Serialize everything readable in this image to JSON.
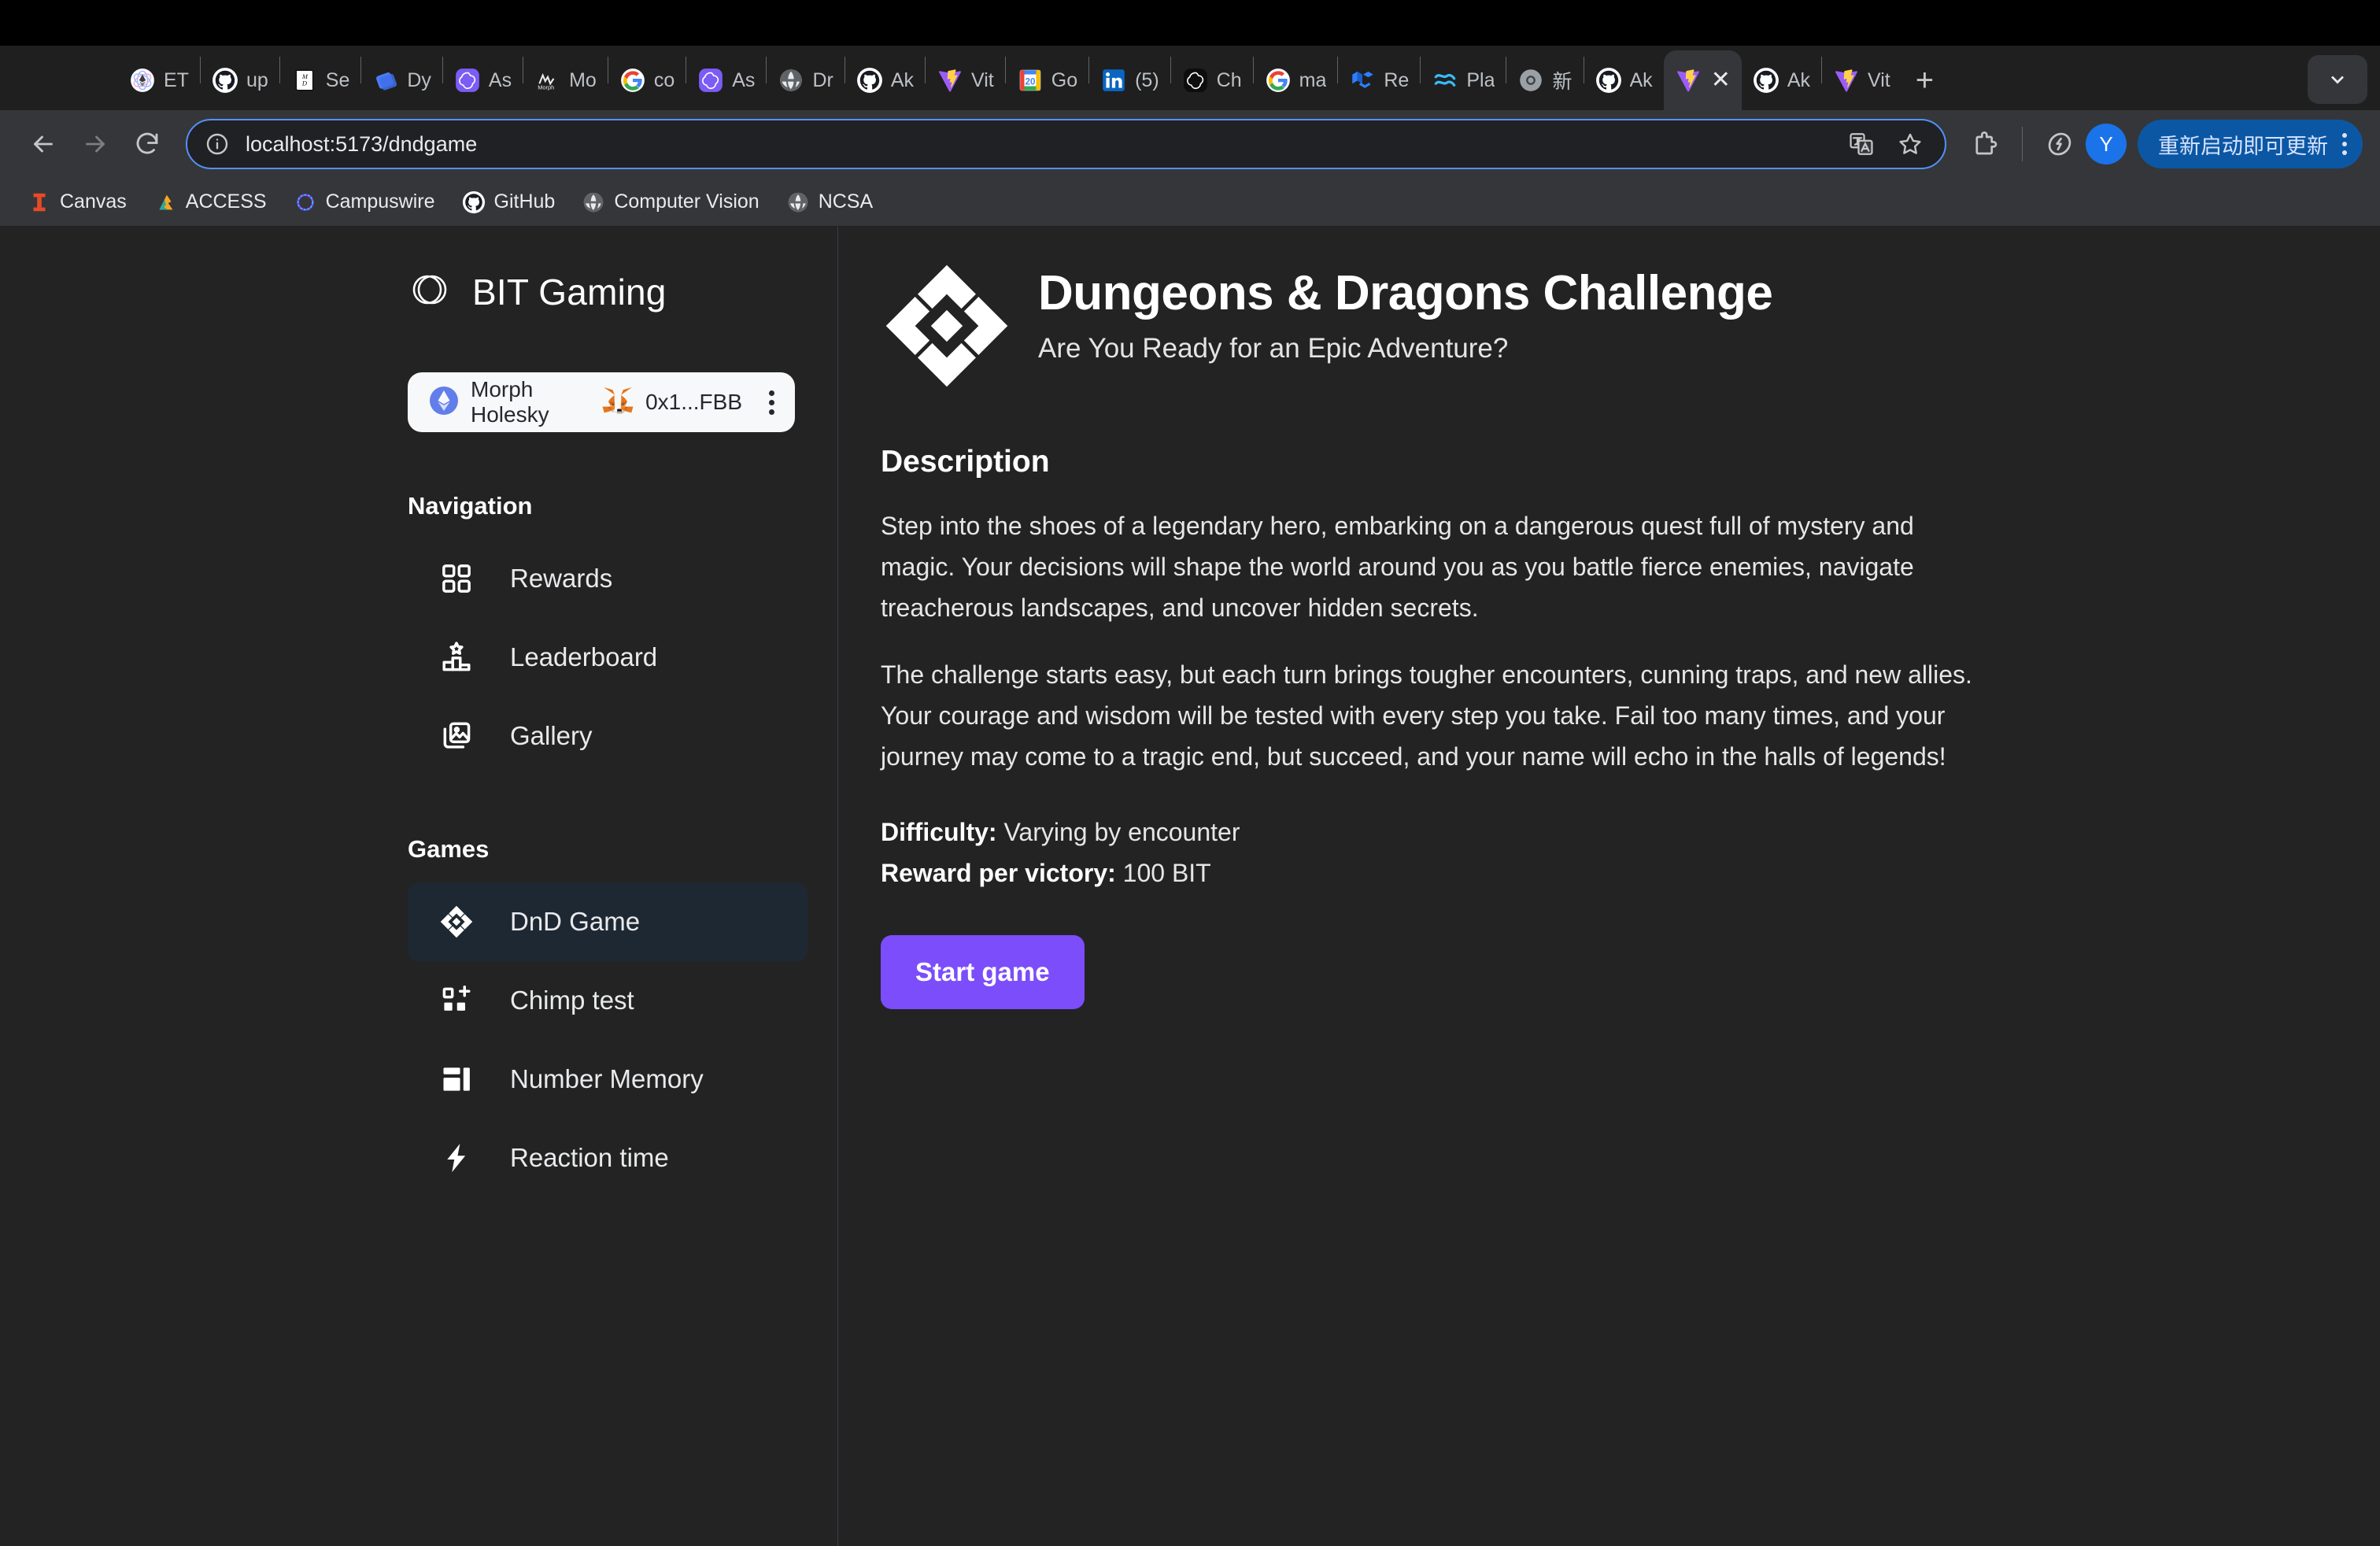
{
  "browser": {
    "nav": {
      "back_icon": "back-arrow-icon",
      "forward_icon": "forward-arrow-icon",
      "reload_icon": "reload-icon"
    },
    "omnibox": {
      "info_icon": "site-info-icon",
      "url": "localhost:5173/dndgame",
      "translate_icon": "translate-icon",
      "bookmark_icon": "star-icon"
    },
    "toolbar": {
      "extensions_icon": "extensions-icon",
      "leaf_icon": "performance-leaf-icon",
      "profile_initial": "Y",
      "update_label": "重新启动即可更新",
      "menu_icon": "kebab-menu-icon"
    },
    "tabstrip": {
      "new_tab_label": "+",
      "tab_list_icon": "chevron-down-icon",
      "tabs": [
        {
          "title": "ET",
          "icon": "ethereum-icon",
          "active": false
        },
        {
          "title": "up",
          "icon": "github-icon",
          "active": false
        },
        {
          "title": "Se",
          "icon": "markdown-book-icon",
          "active": false
        },
        {
          "title": "Dy",
          "icon": "dynamic-blue-icon",
          "active": false
        },
        {
          "title": "As",
          "icon": "openai-purple-icon",
          "active": false
        },
        {
          "title": "Mo",
          "icon": "morph-icon",
          "active": false
        },
        {
          "title": "co",
          "icon": "google-icon",
          "active": false
        },
        {
          "title": "As",
          "icon": "openai-purple-icon",
          "active": false
        },
        {
          "title": "Dr",
          "icon": "globe-icon",
          "active": false
        },
        {
          "title": "Ak",
          "icon": "github-icon",
          "active": false
        },
        {
          "title": "Vit",
          "icon": "vite-icon",
          "active": false
        },
        {
          "title": "Go",
          "icon": "google-calendar-icon",
          "active": false
        },
        {
          "title": "(5)",
          "icon": "linkedin-icon",
          "active": false
        },
        {
          "title": "Ch",
          "icon": "openai-black-icon",
          "active": false
        },
        {
          "title": "ma",
          "icon": "google-icon",
          "active": false
        },
        {
          "title": "Re",
          "icon": "mui-icon",
          "active": false
        },
        {
          "title": "Pla",
          "icon": "supabase-icon",
          "active": false
        },
        {
          "title": "新",
          "icon": "chrome-gray-icon",
          "active": false
        },
        {
          "title": "Ak",
          "icon": "github-icon",
          "active": false
        },
        {
          "title": "",
          "icon": "vite-icon",
          "active": true,
          "close_label": "✕"
        },
        {
          "title": "Ak",
          "icon": "github-icon",
          "active": false
        },
        {
          "title": "Vit",
          "icon": "vite-icon",
          "active": false
        }
      ]
    },
    "bookmarks": [
      {
        "label": "Canvas",
        "icon": "illinois-i-icon"
      },
      {
        "label": "ACCESS",
        "icon": "access-icon"
      },
      {
        "label": "Campuswire",
        "icon": "campuswire-icon"
      },
      {
        "label": "GitHub",
        "icon": "github-icon"
      },
      {
        "label": "Computer Vision",
        "icon": "globe-icon"
      },
      {
        "label": "NCSA",
        "icon": "globe-icon"
      }
    ]
  },
  "app": {
    "brand": {
      "name": "BIT Gaming",
      "logo_icon": "bit-gaming-circle-logo"
    },
    "wallet": {
      "network_icon": "ethereum-diamond-icon",
      "network": "Morph Holesky",
      "account_icon": "metamask-fox-icon",
      "address": "0x1...FBB",
      "menu_icon": "wallet-kebab-icon"
    },
    "sidebar": {
      "sections": [
        {
          "title": "Navigation",
          "items": [
            {
              "label": "Rewards",
              "icon": "grid-icon",
              "active": false
            },
            {
              "label": "Leaderboard",
              "icon": "podium-star-icon",
              "active": false
            },
            {
              "label": "Gallery",
              "icon": "images-icon",
              "active": false
            }
          ]
        },
        {
          "title": "Games",
          "items": [
            {
              "label": "DnD Game",
              "icon": "dnd-diamond-icon",
              "active": true
            },
            {
              "label": "Chimp test",
              "icon": "grid-plus-icon",
              "active": false
            },
            {
              "label": "Number Memory",
              "icon": "layout-blocks-icon",
              "active": false
            },
            {
              "label": "Reaction time",
              "icon": "lightning-bolt-icon",
              "active": false
            }
          ]
        }
      ]
    },
    "main": {
      "hero_icon": "dnd-diamond-large-icon",
      "title": "Dungeons & Dragons Challenge",
      "subtitle": "Are You Ready for an Epic Adventure?",
      "description_heading": "Description",
      "paragraph_1": "Step into the shoes of a legendary hero, embarking on a dangerous quest full of mystery and magic. Your decisions will shape the world around you as you battle fierce enemies, navigate treacherous landscapes, and uncover hidden secrets.",
      "paragraph_2": "The challenge starts easy, but each turn brings tougher encounters, cunning traps, and new allies. Your courage and wisdom will be tested with every step you take. Fail too many times, and your journey may come to a tragic end, but succeed, and your name will echo in the halls of legends!",
      "difficulty_label": "Difficulty:",
      "difficulty_value": "Varying by encounter",
      "reward_label": "Reward per victory:",
      "reward_value": "100 BIT",
      "start_button": "Start game"
    },
    "colors": {
      "accent_purple": "#7c4dfa",
      "page_bg": "#232323",
      "active_item_bg": "#1e2833",
      "wallet_chip_bg": "#f7f8f9"
    }
  }
}
